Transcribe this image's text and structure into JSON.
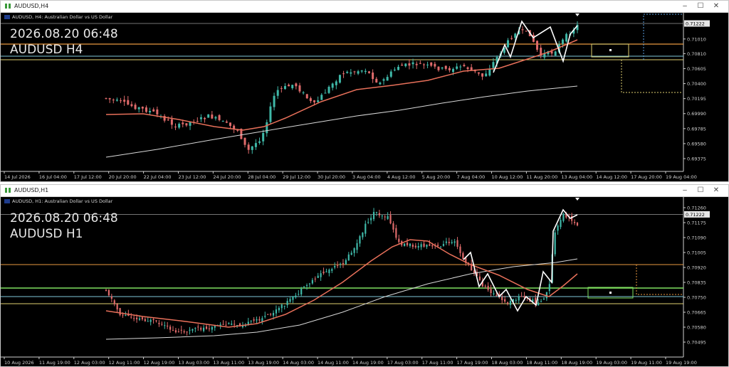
{
  "top_window": {
    "title": "AUDUSD,H4",
    "symbol_line": "AUDUSD, H4:  Australian Dollar vs US Dollar",
    "stamp_datetime": "2026.08.20 06:48",
    "stamp_symbol": "AUDUSD H4",
    "current_price": "0.71222",
    "price_labels": [
      "0.71222",
      "0.71010",
      "0.70810",
      "0.70605",
      "0.70400",
      "0.70195",
      "0.69990",
      "0.69785",
      "0.69580",
      "0.69375"
    ],
    "time_labels": [
      "14 Jul 2026",
      "16 Jul 04:00",
      "17 Jul 12:00",
      "20 Jul 20:00",
      "22 Jul 04:00",
      "23 Jul 12:00",
      "24 Jul 20:00",
      "28 Jul 04:00",
      "29 Jul 12:00",
      "30 Jul 20:00",
      "3 Aug 04:00",
      "4 Aug 12:00",
      "5 Aug 20:00",
      "7 Aug 04:00",
      "10 Aug 12:00",
      "11 Aug 20:00",
      "13 Aug 04:00",
      "14 Aug 12:00",
      "17 Aug 20:00",
      "19 Aug 04:00"
    ]
  },
  "bottom_window": {
    "title": "AUDUSD,H1",
    "symbol_line": "AUDUSD, H1:  Australian Dollar vs US Dollar",
    "stamp_datetime": "2026.08.20 06:48",
    "stamp_symbol": "AUDUSD H1",
    "current_price": "0.71222",
    "price_labels": [
      "0.71260",
      "0.71222",
      "0.71175",
      "0.71090",
      "0.71005",
      "0.70920",
      "0.70835",
      "0.70750",
      "0.70665",
      "0.70580",
      "0.70495"
    ],
    "time_labels": [
      "10 Aug 2026",
      "11 Aug 19:00",
      "12 Aug 03:00",
      "12 Aug 11:00",
      "12 Aug 19:00",
      "13 Aug 03:00",
      "13 Aug 11:00",
      "13 Aug 19:00",
      "14 Aug 03:00",
      "14 Aug 11:00",
      "14 Aug 19:00",
      "17 Aug 03:00",
      "17 Aug 11:00",
      "17 Aug 19:00",
      "18 Aug 03:00",
      "18 Aug 11:00",
      "18 Aug 19:00",
      "19 Aug 03:00",
      "19 Aug 11:00",
      "19 Aug 19:00"
    ]
  },
  "window_controls": {
    "minimize": "–",
    "maximize": "☐",
    "close": "✕"
  },
  "colors": {
    "bull": "#3fb8a8",
    "bear": "#e06b6b",
    "ma_fast": "#e8705a",
    "ma_slow": "#d8d8d8",
    "zigzag": "#ffffff",
    "level_orange": "#e89840",
    "level_cyan": "#7fc8d8",
    "level_yellow": "#e0d070",
    "level_green": "#7fe060",
    "grid_text": "#cfcfcf"
  }
}
